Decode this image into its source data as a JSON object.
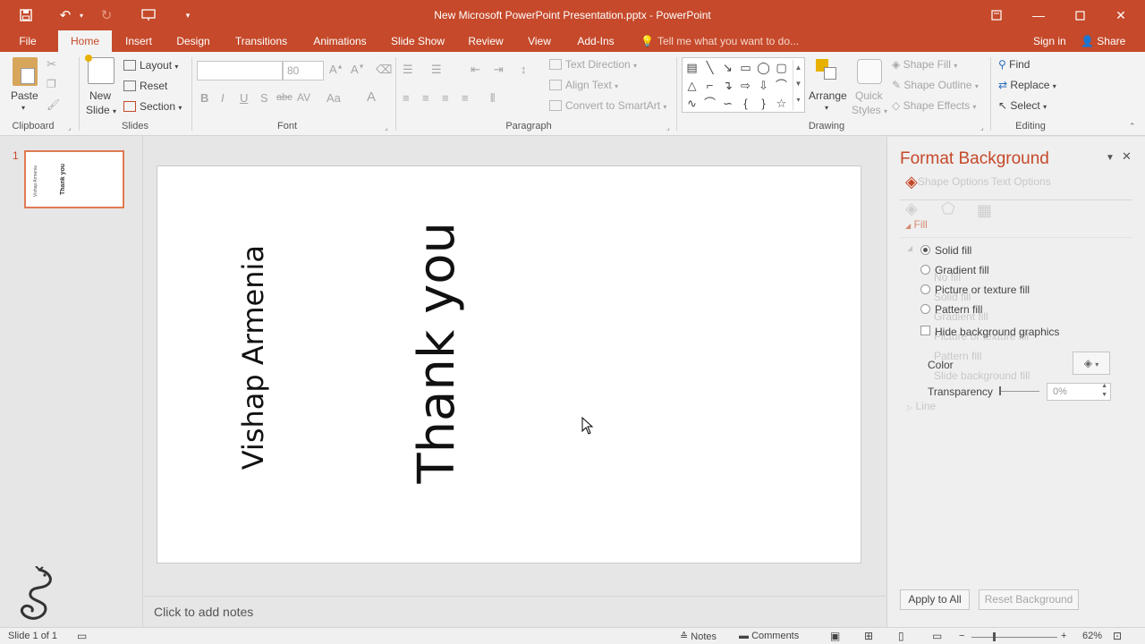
{
  "app": {
    "title": "New Microsoft PowerPoint Presentation.pptx - PowerPoint",
    "accent_color": "#c5492a"
  },
  "quick_access": {
    "icons": [
      "save-icon",
      "undo-icon",
      "redo-icon",
      "present-from-start-icon",
      "customize-icon"
    ]
  },
  "tabs": [
    {
      "label": "File"
    },
    {
      "label": "Home"
    },
    {
      "label": "Insert"
    },
    {
      "label": "Design"
    },
    {
      "label": "Transitions"
    },
    {
      "label": "Animations"
    },
    {
      "label": "Slide Show"
    },
    {
      "label": "Review"
    },
    {
      "label": "View"
    },
    {
      "label": "Add-Ins"
    }
  ],
  "tell_me": "Tell me what you want to do...",
  "sign_in": "Sign in",
  "share": "Share",
  "ribbon": {
    "clipboard": {
      "paste": "Paste",
      "group": "Clipboard"
    },
    "slides": {
      "new_slide_1": "New",
      "new_slide_2": "Slide",
      "layout": "Layout",
      "reset": "Reset",
      "section": "Section",
      "group": "Slides"
    },
    "font": {
      "font_size": "80",
      "group": "Font",
      "bold": "B",
      "italic": "I",
      "underline": "U",
      "shadow": "S",
      "strike": "abc",
      "spacing": "AV",
      "case": "Aa",
      "color": "A"
    },
    "paragraph": {
      "text_direction": "Text Direction",
      "align_text": "Align Text",
      "convert_smartart": "Convert to SmartArt",
      "group": "Paragraph"
    },
    "drawing": {
      "arrange": "Arrange",
      "quick_styles_1": "Quick",
      "quick_styles_2": "Styles",
      "shape_fill": "Shape Fill",
      "shape_outline": "Shape Outline",
      "shape_effects": "Shape Effects",
      "group": "Drawing"
    },
    "editing": {
      "find": "Find",
      "replace": "Replace",
      "select": "Select",
      "group": "Editing"
    }
  },
  "thumbnail": {
    "number": "1",
    "text_small": "Vishap Armenia",
    "text_large": "Thank you"
  },
  "slide": {
    "text_1": "Vishap Armenia",
    "text_2": "Thank you"
  },
  "notes_placeholder": "Click to add notes",
  "format_pane": {
    "title": "Format Background",
    "tab_shape": "Shape Options",
    "tab_text": "Text Options",
    "section_fill": "Fill",
    "options": [
      {
        "label": "Solid fill",
        "selected": true
      },
      {
        "label": "Gradient fill",
        "selected": false
      },
      {
        "label": "Picture or texture fill",
        "selected": false
      },
      {
        "label": "Pattern fill",
        "selected": false
      }
    ],
    "hide_bg": "Hide background graphics",
    "color_label": "Color",
    "transparency_label": "Transparency",
    "transparency_value": "0%",
    "section_line": "Line",
    "ghost": [
      "No fill",
      "Solid fill",
      "Gradient fill",
      "Picture or texture fill",
      "Pattern fill",
      "Slide background fill"
    ],
    "apply_all": "Apply to All",
    "reset_bg": "Reset Background"
  },
  "status": {
    "slide_count": "Slide 1 of 1",
    "notes": "Notes",
    "comments": "Comments",
    "zoom": "62%"
  }
}
